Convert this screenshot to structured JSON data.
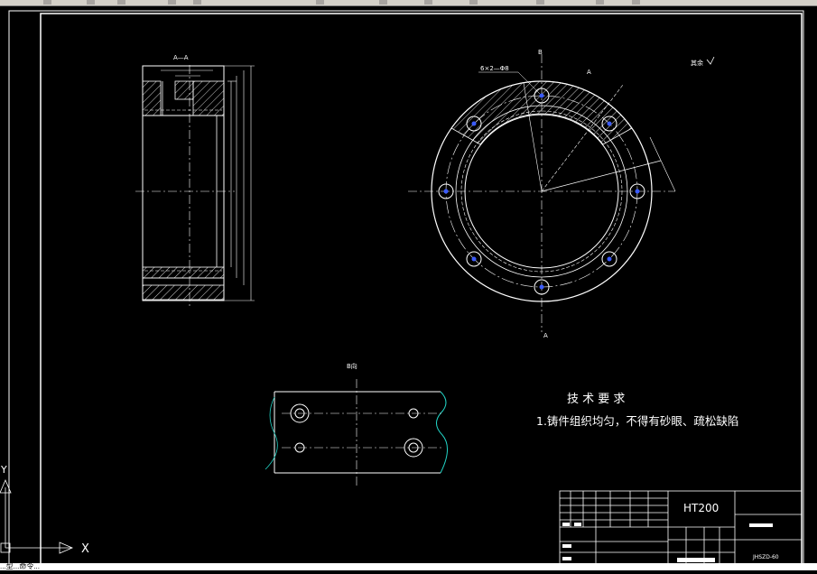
{
  "section_label": "A—A",
  "view_b_label": "B",
  "view_b_header": "B向",
  "section_a_top": "A",
  "section_a_bottom": "A",
  "hole_note": "6×2—Φ8",
  "surface_note": "其余",
  "tech_title": "技 术  要 求",
  "tech_item_1": "1.铸件组织均匀，不得有砂眼、疏松缺陷",
  "material": "HT200",
  "title_block_code": "JHSZD-60",
  "ucs_x_label": "X",
  "ucs_y_label": "Y",
  "command_text": "...型...命令..."
}
